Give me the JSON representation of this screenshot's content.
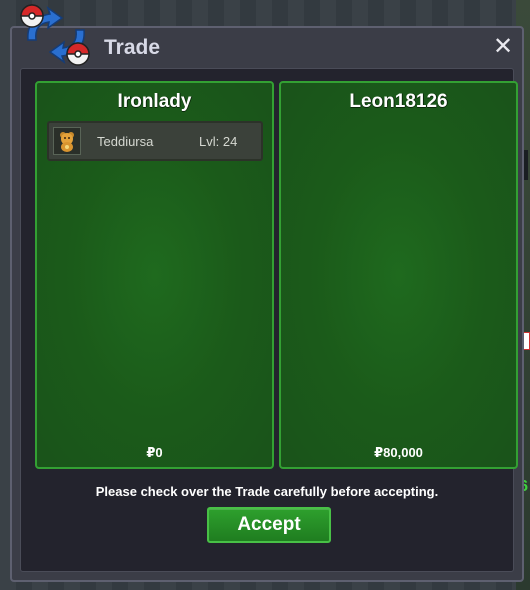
{
  "window": {
    "title": "Trade",
    "close_glyph": "✕"
  },
  "left_panel": {
    "name": "Ironlady",
    "items": [
      {
        "name": "Teddiursa",
        "level": "Lvl: 24",
        "icon": "teddiursa-sprite-icon"
      }
    ],
    "money": "₽0"
  },
  "right_panel": {
    "name": "Leon18126",
    "items": [],
    "money": "₽80,000"
  },
  "notice": "Please check over the Trade carefully before accepting.",
  "accept_label": "Accept",
  "colors": {
    "panel_green": "#1b5b1a",
    "panel_border": "#33a033",
    "accept": "#2e9f2d",
    "window_bg": "#3b3d47"
  }
}
